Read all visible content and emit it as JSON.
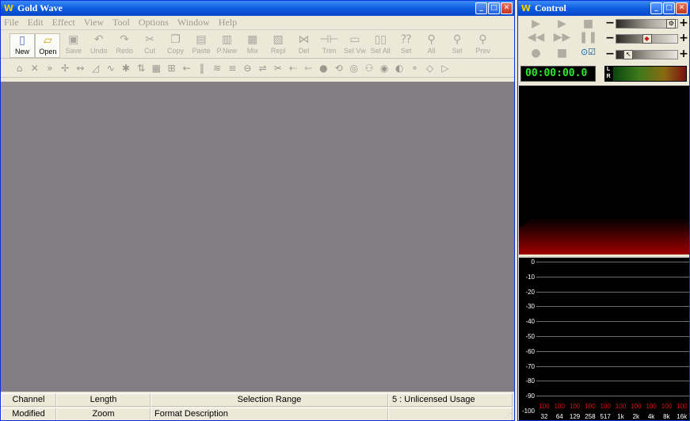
{
  "main": {
    "title": "Gold Wave",
    "menu": [
      "File",
      "Edit",
      "Effect",
      "View",
      "Tool",
      "Options",
      "Window",
      "Help"
    ],
    "toolbar": [
      {
        "label": "New",
        "icon": "new-file-icon",
        "glyph": "▯",
        "enabled": true
      },
      {
        "label": "Open",
        "icon": "open-folder-icon",
        "glyph": "▱",
        "enabled": true
      },
      {
        "label": "Save",
        "icon": "save-disk-icon",
        "glyph": "▣",
        "enabled": false
      },
      {
        "label": "Undo",
        "icon": "undo-icon",
        "glyph": "↶",
        "enabled": false
      },
      {
        "label": "Redo",
        "icon": "redo-icon",
        "glyph": "↷",
        "enabled": false
      },
      {
        "label": "Cut",
        "icon": "scissors-icon",
        "glyph": "✂",
        "enabled": false
      },
      {
        "label": "Copy",
        "icon": "copy-icon",
        "glyph": "❐",
        "enabled": false
      },
      {
        "label": "Paste",
        "icon": "paste-icon",
        "glyph": "▤",
        "enabled": false
      },
      {
        "label": "P.New",
        "icon": "paste-new-icon",
        "glyph": "▥",
        "enabled": false
      },
      {
        "label": "Mix",
        "icon": "mix-icon",
        "glyph": "▦",
        "enabled": false
      },
      {
        "label": "Repl",
        "icon": "replace-icon",
        "glyph": "▧",
        "enabled": false
      },
      {
        "label": "Del",
        "icon": "delete-icon",
        "glyph": "⋈",
        "enabled": false
      },
      {
        "label": "Trim",
        "icon": "trim-icon",
        "glyph": "⊣⊢",
        "enabled": false
      },
      {
        "label": "Sel Vw",
        "icon": "select-view-icon",
        "glyph": "▭",
        "enabled": false
      },
      {
        "label": "Sel All",
        "icon": "select-all-icon",
        "glyph": "▯▯",
        "enabled": false
      },
      {
        "label": "Set",
        "icon": "set-marker-icon",
        "glyph": "⁇",
        "enabled": false
      },
      {
        "label": "All",
        "icon": "zoom-all-icon",
        "glyph": "⚲",
        "enabled": false
      },
      {
        "label": "Sel",
        "icon": "zoom-selection-icon",
        "glyph": "⚲",
        "enabled": false
      },
      {
        "label": "Prev",
        "icon": "zoom-previous-icon",
        "glyph": "⚲",
        "enabled": false
      }
    ],
    "effects_toolbar": [
      {
        "icon": "doppler-icon",
        "glyph": "⌂"
      },
      {
        "icon": "dynamics-icon",
        "glyph": "✕"
      },
      {
        "icon": "echo-icon",
        "glyph": "»"
      },
      {
        "icon": "filter-icon",
        "glyph": "✢"
      },
      {
        "icon": "equalizer-line-icon",
        "glyph": "↔"
      },
      {
        "icon": "fade-in-icon",
        "glyph": "◿"
      },
      {
        "icon": "fade-out-icon",
        "glyph": "∿"
      },
      {
        "icon": "flange-icon",
        "glyph": "✱"
      },
      {
        "icon": "invert-icon",
        "glyph": "⇅"
      },
      {
        "icon": "spectrum-filter-icon",
        "glyph": "▦"
      },
      {
        "icon": "matrix-icon",
        "glyph": "⊞"
      },
      {
        "icon": "mechanize-icon",
        "glyph": "←"
      },
      {
        "icon": "eq-bars-icon",
        "glyph": "‖"
      },
      {
        "icon": "noise-reduction-icon",
        "glyph": "≋"
      },
      {
        "icon": "offset-icon",
        "glyph": "≡"
      },
      {
        "icon": "pan-icon",
        "glyph": "⊖"
      },
      {
        "icon": "pitch-icon",
        "glyph": "⇌"
      },
      {
        "icon": "resample-icon",
        "glyph": "✂"
      },
      {
        "icon": "reverb-icon",
        "glyph": "⇠"
      },
      {
        "icon": "reverse-icon",
        "glyph": "⇽"
      },
      {
        "icon": "silence-icon",
        "glyph": "●"
      },
      {
        "icon": "stereo-icon",
        "glyph": "⟲"
      },
      {
        "icon": "time-warp-icon",
        "glyph": "◎"
      },
      {
        "icon": "volume-icon",
        "glyph": "⚇"
      },
      {
        "icon": "volume-shape-icon",
        "glyph": "◉"
      },
      {
        "icon": "maximize-icon",
        "glyph": "◐"
      },
      {
        "icon": "match-volume-icon",
        "glyph": "⚬"
      },
      {
        "icon": "play-region-icon",
        "glyph": "◇"
      },
      {
        "icon": "effect-play-icon",
        "glyph": "▷"
      }
    ],
    "status_row1": [
      "Channel",
      "Length",
      "Selection Range",
      "5 : Unlicensed Usage"
    ],
    "status_row2": [
      "Modified",
      "Zoom",
      "Format Description",
      ""
    ]
  },
  "control": {
    "title": "Control",
    "time": "00:00:00.0",
    "lr_labels": [
      "L",
      "R"
    ],
    "sliders": [
      {
        "name": "volume-slider",
        "knob_icon": "volume-knob-icon",
        "knob_glyph": "⚙",
        "level": 0.9
      },
      {
        "name": "balance-slider",
        "knob_icon": "balance-knob-icon",
        "knob_glyph": "◆",
        "level": 0.5
      },
      {
        "name": "speed-slider",
        "knob_icon": "speed-knob-icon",
        "knob_glyph": "↖",
        "level": 0.2
      }
    ],
    "spectrum_y": [
      "0",
      "-10",
      "-20",
      "-30",
      "-40",
      "-50",
      "-60",
      "-70",
      "-80",
      "-90",
      "-100"
    ],
    "spectrum_x": [
      "32",
      "64",
      "129",
      "258",
      "517",
      "1k",
      "2k",
      "4k",
      "8k",
      "16k"
    ],
    "band_values": [
      "100",
      "100",
      "100",
      "100",
      "100",
      "100",
      "100",
      "100",
      "100",
      "100"
    ]
  }
}
